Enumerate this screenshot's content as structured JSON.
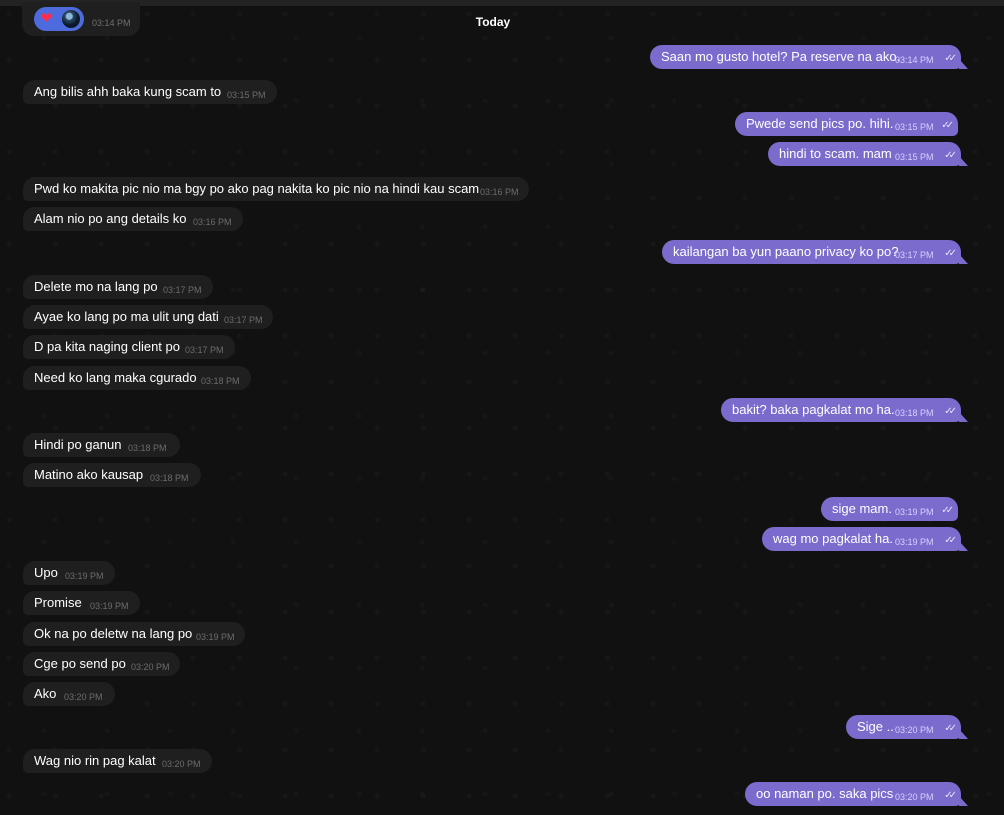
{
  "day_divider": "Today",
  "reaction": {
    "emoji": "❤",
    "time": "03:14 PM"
  },
  "messages": [
    {
      "dir": "out",
      "text": "Saan mo gusto hotel? Pa reserve na ako.",
      "time": "03:14 PM"
    },
    {
      "dir": "in",
      "text": "Ang bilis ahh baka kung scam to",
      "time": "03:15 PM"
    },
    {
      "dir": "out",
      "text": "Pwede send pics po. hihi.",
      "time": "03:15 PM"
    },
    {
      "dir": "out",
      "text": "hindi to scam. mam",
      "time": "03:15 PM"
    },
    {
      "dir": "in",
      "text": "Pwd ko makita pic nio ma bgy po ako pag nakita ko pic nio na hindi kau scam",
      "time": "03:16 PM"
    },
    {
      "dir": "in",
      "text": "Alam nio po ang details ko",
      "time": "03:16 PM"
    },
    {
      "dir": "out",
      "text": "kailangan ba yun paano privacy ko po?",
      "time": "03:17 PM"
    },
    {
      "dir": "in",
      "text": "Delete mo na lang po",
      "time": "03:17 PM"
    },
    {
      "dir": "in",
      "text": "Ayae ko lang po ma ulit ung dati",
      "time": "03:17 PM"
    },
    {
      "dir": "in",
      "text": "D pa kita naging client po",
      "time": "03:17 PM"
    },
    {
      "dir": "in",
      "text": "Need ko lang maka cgurado",
      "time": "03:18 PM"
    },
    {
      "dir": "out",
      "text": "bakit? baka pagkalat mo ha.",
      "time": "03:18 PM"
    },
    {
      "dir": "in",
      "text": "Hindi po ganun",
      "time": "03:18 PM"
    },
    {
      "dir": "in",
      "text": "Matino ako kausap",
      "time": "03:18 PM"
    },
    {
      "dir": "out",
      "text": "sige mam.",
      "time": "03:19 PM"
    },
    {
      "dir": "out",
      "text": "wag mo pagkalat ha.",
      "time": "03:19 PM"
    },
    {
      "dir": "in",
      "text": "Upo",
      "time": "03:19 PM"
    },
    {
      "dir": "in",
      "text": "Promise",
      "time": "03:19 PM"
    },
    {
      "dir": "in",
      "text": "Ok na po deletw na lang po",
      "time": "03:19 PM"
    },
    {
      "dir": "in",
      "text": "Cge po send po",
      "time": "03:20 PM"
    },
    {
      "dir": "in",
      "text": "Ako",
      "time": "03:20 PM"
    },
    {
      "dir": "out",
      "text": "Sige ..",
      "time": "03:20 PM"
    },
    {
      "dir": "in",
      "text": "Wag nio rin pag kalat",
      "time": "03:20 PM"
    },
    {
      "dir": "out",
      "text": "oo naman po. saka pics",
      "time": "03:20 PM"
    }
  ]
}
